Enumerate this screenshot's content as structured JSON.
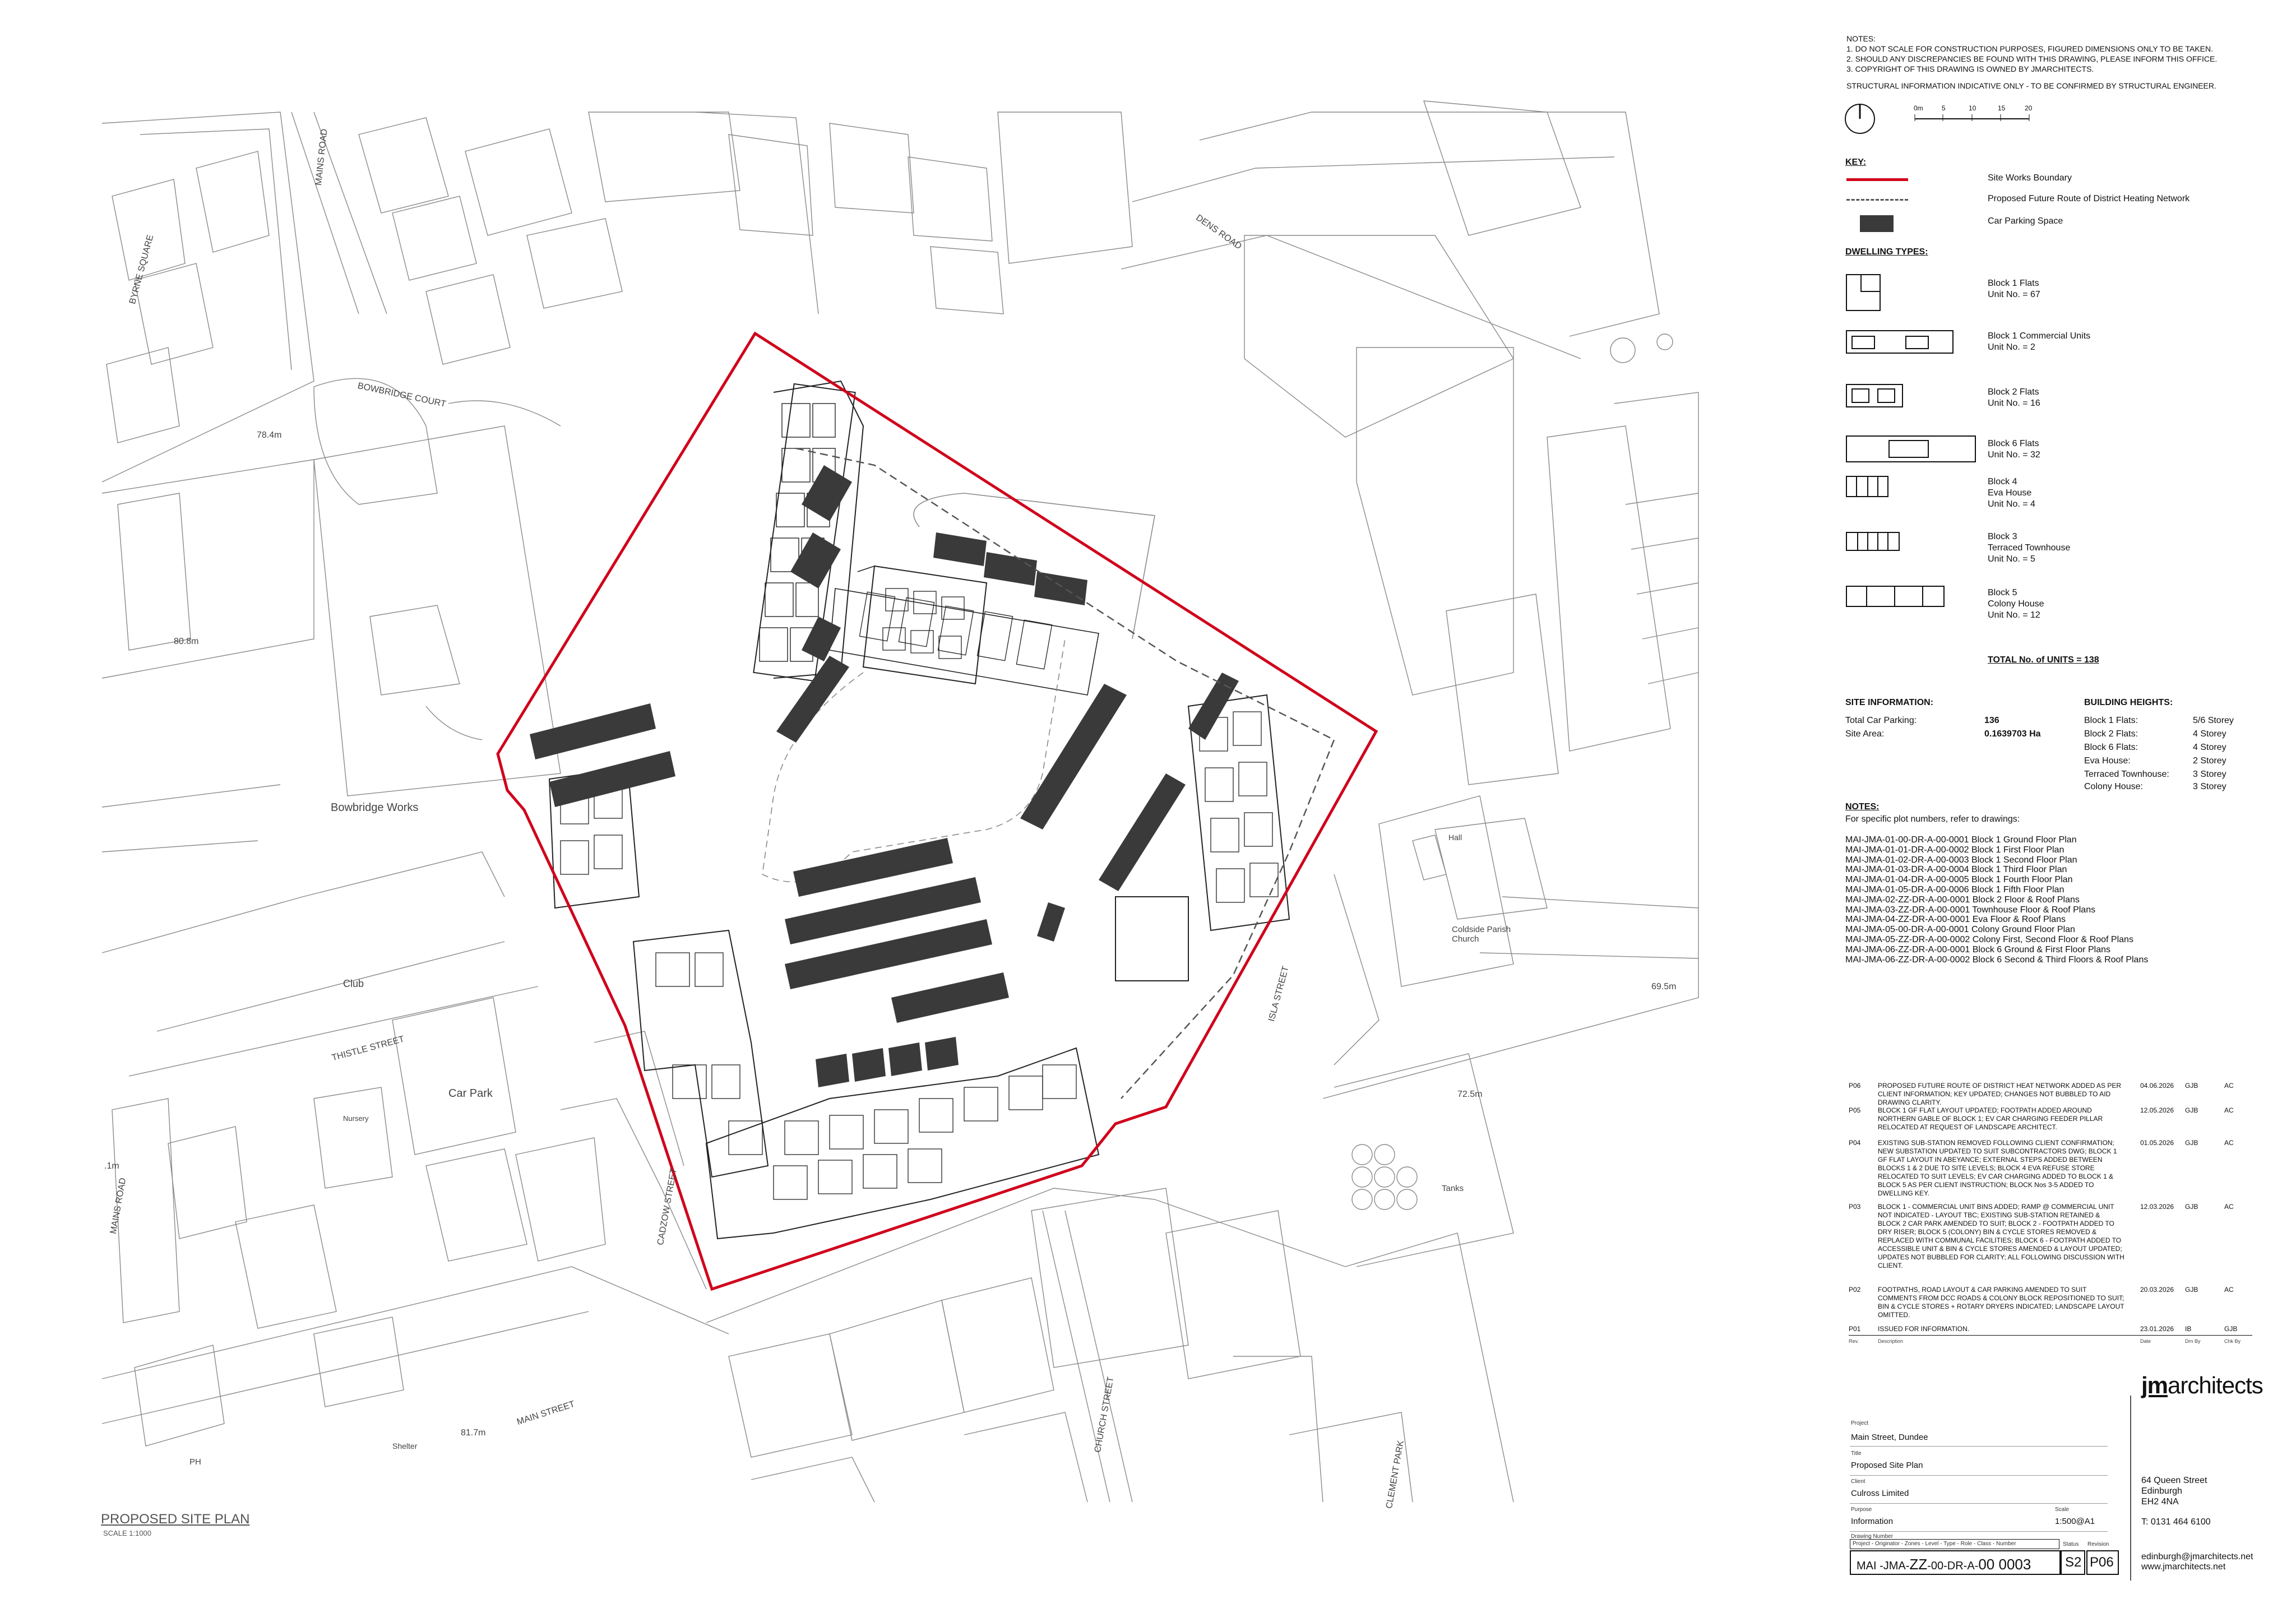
{
  "plan": {
    "title": "PROPOSED SITE PLAN",
    "scale": "SCALE 1:1000",
    "street_labels": {
      "mains_road_top": "MAINS ROAD",
      "byrne_square": "BYRNE SQUARE",
      "bowbridge_court": "BOWBRIDGE COURT",
      "dens_road": "DENS ROAD",
      "thistle_street": "THISTLE STREET",
      "cadzow_street": "CADZOW STREET",
      "main_street": "MAIN STREET",
      "church_street": "CHURCH STREET",
      "isla_street": "ISLA STREET",
      "mains_road_left": "MAINS ROAD",
      "clement_park": "CLEMENT PARK"
    },
    "place_labels": {
      "bowbridge_works": "Bowbridge Works",
      "club": "Club",
      "car_park": "Car Park",
      "nursery": "Nursery",
      "hall": "Hall",
      "church": "Coldside Parish\nChurch",
      "tanks": "Tanks",
      "shelter": "Shelter",
      "ph": "PH"
    },
    "levels": {
      "l1": "78.4m",
      "l2": "80.8m",
      "l3": "69.5m",
      "l4": "72.5m",
      "l5": "81.7m",
      "l6": ".1m"
    }
  },
  "notes_top": {
    "heading": "NOTES:",
    "lines": [
      "1.  DO NOT SCALE FOR CONSTRUCTION PURPOSES, FIGURED DIMENSIONS ONLY TO BE TAKEN.",
      "2.  SHOULD ANY DISCREPANCIES BE FOUND WITH THIS DRAWING, PLEASE INFORM THIS OFFICE.",
      "3.  COPYRIGHT OF THIS DRAWING IS OWNED BY JMARCHITECTS."
    ],
    "structural": "STRUCTURAL INFORMATION INDICATIVE ONLY - TO BE CONFIRMED BY STRUCTURAL ENGINEER."
  },
  "scale_bar": {
    "ticks": [
      "0m",
      "5",
      "10",
      "15",
      "20"
    ]
  },
  "key": {
    "heading": "KEY:",
    "items": [
      "Site Works Boundary",
      "Proposed Future Route of District Heating Network",
      "Car Parking Space"
    ]
  },
  "dwelling_types": {
    "heading": "DWELLING TYPES:",
    "items": [
      {
        "lines": [
          "Block 1 Flats",
          "Unit No. = 67"
        ]
      },
      {
        "lines": [
          "Block 1 Commercial Units",
          "Unit No. = 2"
        ]
      },
      {
        "lines": [
          "Block 2 Flats",
          "Unit No. = 16"
        ]
      },
      {
        "lines": [
          "Block 6 Flats",
          "Unit No. = 32"
        ]
      },
      {
        "lines": [
          "Block 4",
          "Eva House",
          "Unit No. = 4"
        ]
      },
      {
        "lines": [
          "Block 3",
          "Terraced Townhouse",
          "Unit No. = 5"
        ]
      },
      {
        "lines": [
          "Block 5",
          "Colony House",
          "Unit No. = 12"
        ]
      }
    ],
    "total": "TOTAL No. of UNITS = 138"
  },
  "site_info": {
    "heading": "SITE INFORMATION:",
    "rows": [
      {
        "label": "Total Car Parking:",
        "value": "136"
      },
      {
        "label": "Site Area:",
        "value": "0.1639703 Ha"
      }
    ]
  },
  "building_heights": {
    "heading": "BUILDING HEIGHTS:",
    "rows": [
      {
        "label": "Block 1 Flats:",
        "value": "5/6 Storey"
      },
      {
        "label": "Block 2 Flats:",
        "value": "4 Storey"
      },
      {
        "label": "Block 6 Flats:",
        "value": "4 Storey"
      },
      {
        "label": "Eva House:",
        "value": "2 Storey"
      },
      {
        "label": "Terraced Townhouse:",
        "value": "3 Storey"
      },
      {
        "label": "Colony House:",
        "value": "3 Storey"
      }
    ]
  },
  "notes_bottom": {
    "heading": "NOTES:",
    "intro": "For specific plot numbers, refer to drawings:",
    "drawings": [
      "MAI-JMA-01-00-DR-A-00-0001 Block 1 Ground Floor Plan",
      "MAI-JMA-01-01-DR-A-00-0002 Block 1 First Floor Plan",
      "MAI-JMA-01-02-DR-A-00-0003 Block 1 Second Floor Plan",
      "MAI-JMA-01-03-DR-A-00-0004 Block 1 Third Floor Plan",
      "MAI-JMA-01-04-DR-A-00-0005 Block 1 Fourth Floor Plan",
      "MAI-JMA-01-05-DR-A-00-0006 Block 1 Fifth Floor Plan",
      "MAI-JMA-02-ZZ-DR-A-00-0001 Block 2 Floor & Roof Plans",
      "MAI-JMA-03-ZZ-DR-A-00-0001 Townhouse Floor & Roof Plans",
      "MAI-JMA-04-ZZ-DR-A-00-0001 Eva Floor & Roof Plans",
      "MAI-JMA-05-00-DR-A-00-0001 Colony Ground Floor Plan",
      "MAI-JMA-05-ZZ-DR-A-00-0002 Colony First, Second Floor & Roof Plans",
      "MAI-JMA-06-ZZ-DR-A-00-0001 Block 6 Ground & First Floor Plans",
      "MAI-JMA-06-ZZ-DR-A-00-0002 Block 6 Second & Third Floors & Roof Plans"
    ]
  },
  "revisions": {
    "rows": [
      {
        "code": "P06",
        "desc": "PROPOSED FUTURE ROUTE OF DISTRICT HEAT NETWORK ADDED AS PER CLIENT INFORMATION; KEY UPDATED; CHANGES NOT BUBBLED TO AID DRAWING CLARITY.",
        "date": "04.06.2026",
        "drawn": "GJB",
        "checked": "AC"
      },
      {
        "code": "P05",
        "desc": "BLOCK 1 GF FLAT LAYOUT UPDATED; FOOTPATH ADDED AROUND NORTHERN GABLE OF BLOCK 1; EV CAR CHARGING FEEDER PILLAR RELOCATED AT REQUEST OF LANDSCAPE ARCHITECT.",
        "date": "12.05.2026",
        "drawn": "GJB",
        "checked": "AC"
      },
      {
        "code": "P04",
        "desc": "EXISTING SUB-STATION REMOVED FOLLOWING CLIENT CONFIRMATION; NEW SUBSTATION UPDATED TO SUIT SUBCONTRACTORS DWG; BLOCK 1 GF FLAT LAYOUT IN ABEYANCE; EXTERNAL STEPS ADDED BETWEEN BLOCKS 1 & 2 DUE TO SITE LEVELS; BLOCK 4 EVA REFUSE STORE RELOCATED TO SUIT LEVELS; EV CAR CHARGING ADDED TO BLOCK 1 & BLOCK 5 AS PER CLIENT INSTRUCTION; BLOCK Nos 3-5 ADDED TO DWELLING KEY.",
        "date": "01.05.2026",
        "drawn": "GJB",
        "checked": "AC"
      },
      {
        "code": "P03",
        "desc": "BLOCK 1 - COMMERCIAL UNIT BINS ADDED; RAMP @ COMMERCIAL UNIT NOT INDICATED - LAYOUT TBC; EXISTING SUB-STATION RETAINED & BLOCK 2 CAR PARK AMENDED TO SUIT; BLOCK 2 - FOOTPATH ADDED TO DRY RISER; BLOCK 5 (COLONY) BIN & CYCLE STORES REMOVED & REPLACED WITH COMMUNAL FACILITIES; BLOCK 6 - FOOTPATH ADDED TO ACCESSIBLE UNIT & BIN & CYCLE STORES AMENDED & LAYOUT UPDATED; UPDATES NOT BUBBLED FOR CLARITY; ALL FOLLOWING DISCUSSION WITH CLIENT.",
        "date": "12.03.2026",
        "drawn": "GJB",
        "checked": "AC"
      },
      {
        "code": "P02",
        "desc": "FOOTPATHS, ROAD LAYOUT & CAR PARKING AMENDED TO SUIT COMMENTS FROM DCC ROADS & COLONY BLOCK REPOSITIONED TO SUIT; BIN & CYCLE STORES + ROTARY DRYERS INDICATED; LANDSCAPE LAYOUT OMITTED.",
        "date": "20.03.2026",
        "drawn": "GJB",
        "checked": "AC"
      },
      {
        "code": "P01",
        "desc": "ISSUED FOR INFORMATION.",
        "date": "23.01.2026",
        "drawn": "IB",
        "checked": "GJB"
      }
    ],
    "headers": {
      "rev": "Rev.",
      "desc": "Description",
      "date": "Date",
      "drawn": "Drn By",
      "checked": "Chk By"
    }
  },
  "title_block": {
    "labels": {
      "project": "Project",
      "title": "Title",
      "client": "Client",
      "purpose": "Purpose",
      "scale": "Scale",
      "drawing_number": "Drawing Number",
      "number_format": "Project - Originator - Zones - Level - Type - Role - Class - Number",
      "status": "Status",
      "revision": "Revision"
    },
    "project": "Main Street, Dundee",
    "title": "Proposed Site Plan",
    "client": "Culross Limited",
    "purpose": "Information",
    "scale": "1:500@A1",
    "drawing_number_parts": [
      "MAI -JMA-",
      "ZZ",
      "-",
      "00",
      "-DR-A-",
      "00 0003"
    ],
    "status": "S2",
    "revision": "P06"
  },
  "firm": {
    "logo_jm": "jm",
    "logo_rest": "architects",
    "address": [
      "64 Queen Street",
      "Edinburgh",
      "EH2 4NA"
    ],
    "phone": "T:  0131 464 6100",
    "email": "edinburgh@jmarchitects.net",
    "web": "www.jmarchitects.net"
  },
  "colors": {
    "boundary": "#d0021b",
    "line": "#8a8a8a",
    "building": "#222222",
    "parking": "#3a3a3a"
  }
}
